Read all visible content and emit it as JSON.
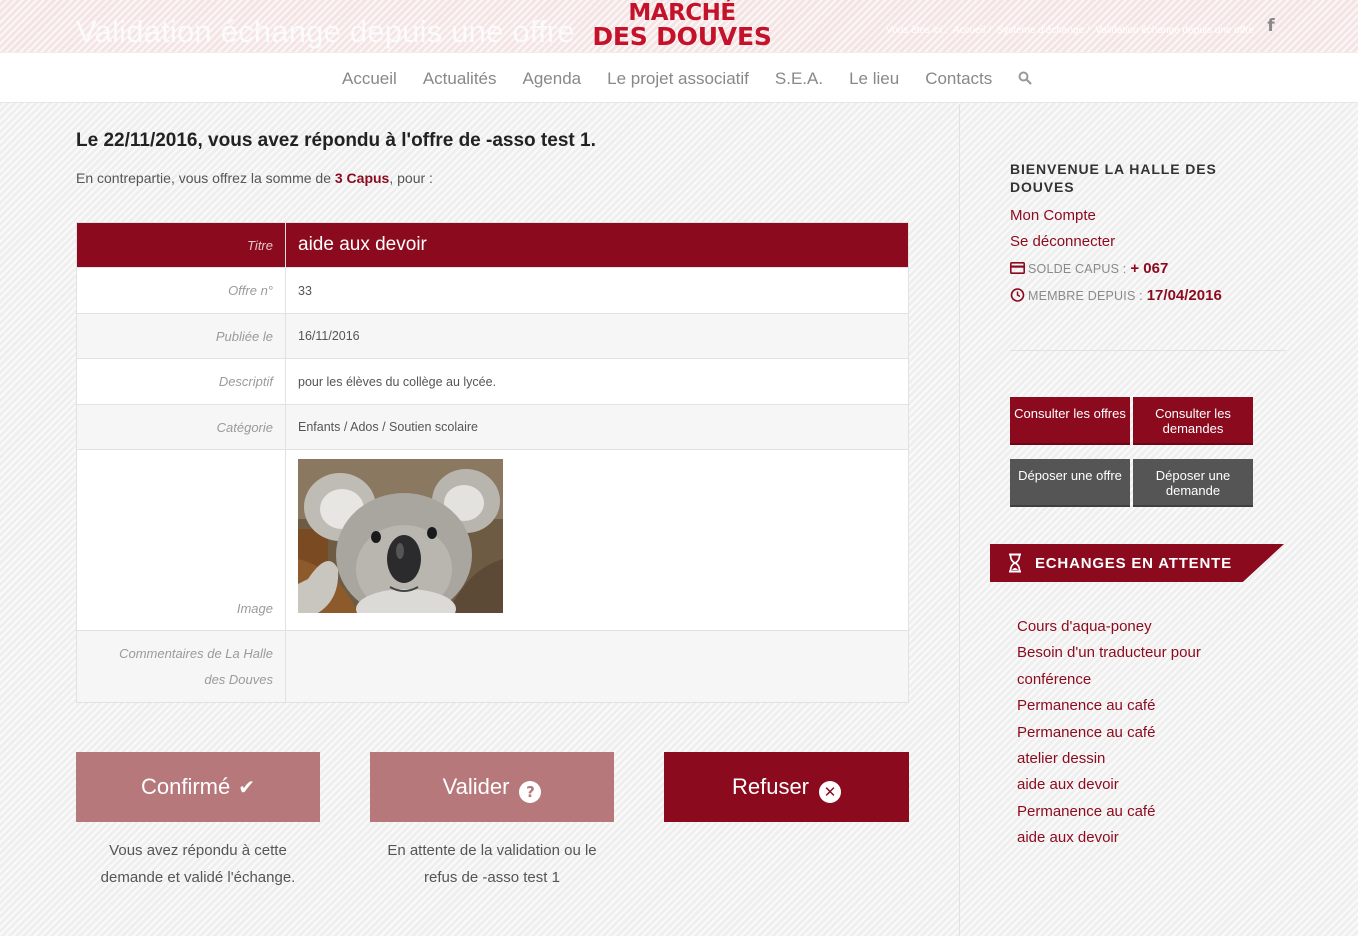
{
  "header": {
    "page_title": "Validation échange depuis une offre",
    "logo_line1": "MARCHÉ",
    "logo_line2": "DES DOUVES",
    "breadcrumb": {
      "prefix": "Vous êtes ici :",
      "items": [
        "Accueil",
        "/",
        "Système d'échange",
        "/",
        "Validation échange depuis une offre"
      ]
    },
    "social_icon": "facebook-icon"
  },
  "nav": {
    "items": [
      "Accueil",
      "Actualités",
      "Agenda",
      "Le projet associatif",
      "S.E.A.",
      "Le lieu",
      "Contacts"
    ],
    "search_icon": "search-icon"
  },
  "main": {
    "heading": "Le 22/11/2016, vous avez répondu à l'offre de -asso test 1.",
    "sub_prefix": "En contrepartie, vous offrez la somme de",
    "sub_amount": "3 Capus",
    "sub_suffix": ", pour :",
    "table": {
      "title_label": "Titre",
      "title_value": "aide aux devoir",
      "rows": [
        {
          "label": "Offre n°",
          "value": "33"
        },
        {
          "label": "Publiée le",
          "value": "16/11/2016"
        },
        {
          "label": "Descriptif",
          "value": "pour les élèves du collège au lycée."
        },
        {
          "label": "Catégorie",
          "value": "Enfants / Ados / Soutien scolaire"
        }
      ],
      "image_label": "Image",
      "comments_label": "Commentaires de La Halle des Douves",
      "comments_value": ""
    },
    "actions": {
      "confirm": {
        "label": "Confirmé",
        "note": "Vous avez répondu à cette demande et validé l'échange."
      },
      "validate": {
        "label": "Valider",
        "note": "En attente de la validation ou le refus de -asso test 1"
      },
      "refuse": {
        "label": "Refuser"
      }
    }
  },
  "sidebar": {
    "welcome": "BIENVENUE LA HALLE DES DOUVES",
    "account_link": "Mon Compte",
    "logout_link": "Se déconnecter",
    "balance_label": "SOLDE CAPUS :",
    "balance_value": "+ 067",
    "member_label": "MEMBRE DEPUIS :",
    "member_value": "17/04/2016",
    "buttons": {
      "view_offers": "Consulter les offres",
      "view_requests": "Consulter les demandes",
      "post_offer": "Déposer une offre",
      "post_request": "Déposer une demande"
    },
    "pending_title": "ECHANGES EN ATTENTE",
    "pending": [
      "Cours d'aqua-poney",
      "Besoin d'un traducteur pour conférence",
      "Permanence au café",
      "Permanence au café",
      "atelier dessin",
      "aide aux devoir",
      "Permanence au café",
      "aide aux devoir"
    ]
  },
  "colors": {
    "brand_red": "#8c0a1e",
    "logo_red": "#c4122a",
    "muted_button": "#b7787b",
    "dark_button": "#555555"
  }
}
